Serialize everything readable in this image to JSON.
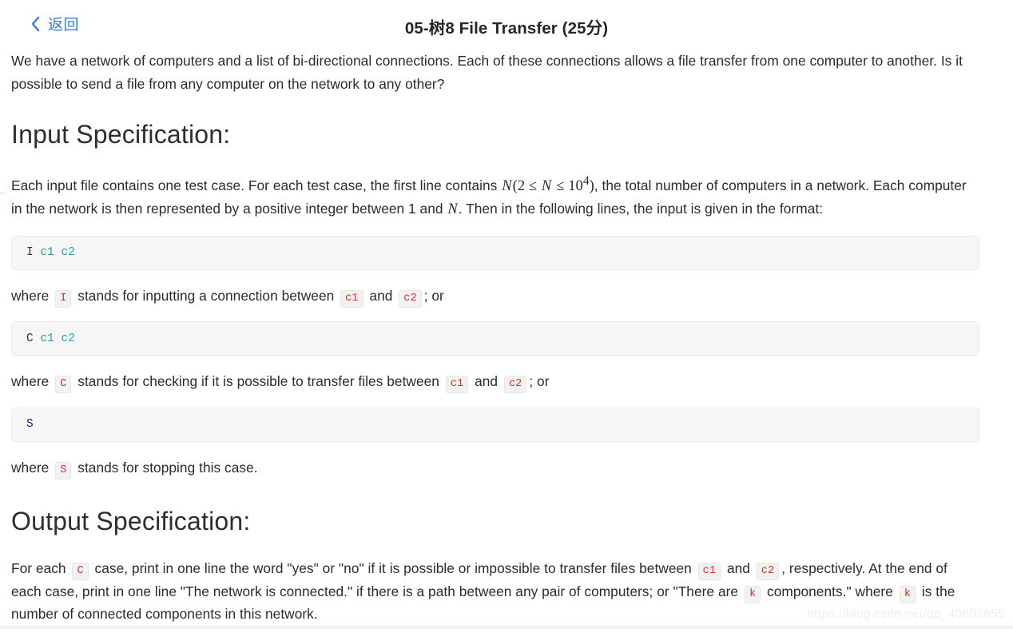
{
  "header": {
    "back_label": "返回",
    "back_icon": "chevron-left-icon",
    "title": "05-树8 File Transfer (25分)",
    "accent_color": "#2f7fe0",
    "title_color": "#23272b"
  },
  "intro": {
    "text": "We have a network of computers and a list of bi-directional connections. Each of these connections allows a file transfer from one computer to another. Is it possible to send a file from any computer on the network to any other?"
  },
  "input_spec": {
    "heading": "Input Specification:",
    "para_part1": "Each input file contains one test case. For each test case, the first line contains ",
    "math_n1": "N",
    "math_range_open": "(2 ",
    "math_le1": "≤",
    "math_n2": "N",
    "math_le2": "≤",
    "math_pow_base": "10",
    "math_pow_exp": "4",
    "math_close": ")",
    "para_part2": ", the total number of computers in a network. Each computer in the network is then represented by a positive integer between 1 and ",
    "math_n3": "N",
    "para_part3": ". Then in the following lines, the input is given in the format:"
  },
  "code_blocks": [
    {
      "cmd": "I",
      "args": "c1 c2"
    },
    {
      "cmd": "C",
      "args": "c1 c2"
    },
    {
      "cmd": "S",
      "args": ""
    }
  ],
  "where_lines": [
    {
      "prefix": "where",
      "chip1": "I",
      "mid": "stands for inputting a connection between",
      "chip2": "c1",
      "join": "and",
      "chip3": "c2",
      "suffix": "; or"
    },
    {
      "prefix": "where",
      "chip1": "C",
      "mid": "stands for checking if it is possible to transfer files between",
      "chip2": "c1",
      "join": "and",
      "chip3": "c2",
      "suffix": "; or"
    },
    {
      "prefix": "where",
      "chip1": "S",
      "mid": "stands for stopping this case.",
      "chip2": "",
      "join": "",
      "chip3": "",
      "suffix": ""
    }
  ],
  "output_spec": {
    "heading": "Output Specification:",
    "seg1": "For each",
    "chip_c": "C",
    "seg2": "case, print in one line the word \"yes\" or \"no\" if it is possible or impossible to transfer files between",
    "chip_c1": "c1",
    "seg3": "and",
    "chip_c2": "c2",
    "seg4": ", respectively. At the end of each case, print in one line \"The network is connected.\" if there is a path between any pair of computers; or \"There are",
    "chip_k1": "k",
    "seg5": "components.\" where",
    "chip_k2": "k",
    "seg6": "is the number of connected components in this network."
  },
  "watermark": {
    "text": "https://blog.csdn.net/qq_40602655"
  },
  "colors": {
    "inline_code_text": "#e02b2b",
    "inline_code_bg": "#f2f2f2",
    "code_block_bg": "#f6f6f6",
    "code_arg": "#2f9aa8",
    "link_blue": "#2f7fe0"
  }
}
